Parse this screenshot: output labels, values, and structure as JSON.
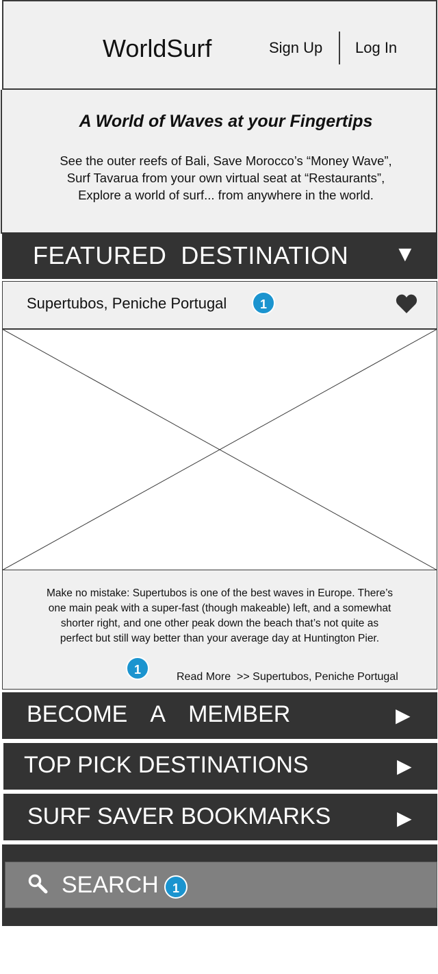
{
  "header": {
    "app_title": "WorldSurf",
    "sign_up": "Sign Up",
    "log_in": "Log In"
  },
  "hero": {
    "title": "A World of Waves at your Fingertips",
    "lines": [
      "See the outer reefs of Bali, Save Morocco’s “Money Wave”,",
      "Surf Tavarua from your own virtual seat at “Restaurants”,",
      "Explore a world of surf... from anywhere in the world."
    ]
  },
  "featured": {
    "label": "FEATURED  DESTINATION",
    "toggle_icon": "▼",
    "destination": "Supertubos, Peniche Portugal",
    "badge": "1",
    "favorite_icon": "heart-icon",
    "description_lines": [
      "Make no mistake: Supertubos is one of the best waves in Europe. There’s",
      "one main peak with a super-fast (though makeable) left, and a somewhat",
      "shorter right, and one other peak down the beach that’s not quite as",
      "perfect but still way better than your average day at Huntington Pier."
    ],
    "read_more_badge": "1",
    "read_more": "Read More  >> Supertubos, Peniche Portugal"
  },
  "nav": {
    "member": "BECOME  A  MEMBER",
    "top_picks": "TOP PICK DESTINATIONS",
    "bookmarks": "SURF SAVER BOOKMARKS",
    "arrow": "▶"
  },
  "search": {
    "label": "SEARCH",
    "badge": "1",
    "icon": "search-icon"
  },
  "colors": {
    "bar_dark": "#333333",
    "panel_light": "#f0f0f0",
    "search_field": "#808080",
    "badge_blue": "#1b94cf"
  }
}
